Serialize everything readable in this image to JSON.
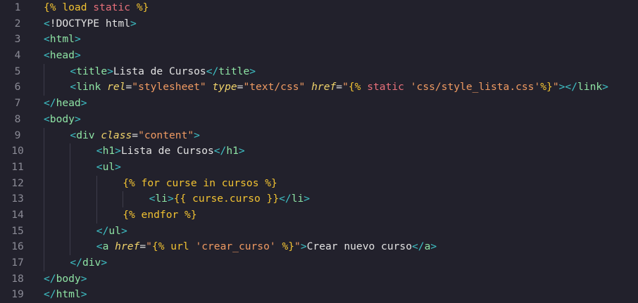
{
  "editor": {
    "lines": [
      {
        "n": "1",
        "indent": 0,
        "tokens": [
          [
            "tpl",
            "{% "
          ],
          [
            "tpl",
            "load "
          ],
          [
            "kw",
            "static "
          ],
          [
            "tpl",
            "%}"
          ]
        ]
      },
      {
        "n": "2",
        "indent": 0,
        "tokens": [
          [
            "br",
            "<"
          ],
          [
            "txt",
            "!DOCTYPE html"
          ],
          [
            "br",
            ">"
          ]
        ]
      },
      {
        "n": "3",
        "indent": 0,
        "tokens": [
          [
            "br",
            "<"
          ],
          [
            "tag",
            "html"
          ],
          [
            "br",
            ">"
          ]
        ]
      },
      {
        "n": "4",
        "indent": 0,
        "tokens": [
          [
            "br",
            "<"
          ],
          [
            "tag",
            "head"
          ],
          [
            "br",
            ">"
          ]
        ]
      },
      {
        "n": "5",
        "indent": 1,
        "tokens": [
          [
            "br",
            "<"
          ],
          [
            "tag",
            "title"
          ],
          [
            "br",
            ">"
          ],
          [
            "txt",
            "Lista de Cursos"
          ],
          [
            "br",
            "</"
          ],
          [
            "tag",
            "title"
          ],
          [
            "br",
            ">"
          ]
        ]
      },
      {
        "n": "6",
        "indent": 1,
        "tokens": [
          [
            "br",
            "<"
          ],
          [
            "tag",
            "link "
          ],
          [
            "attr",
            "rel"
          ],
          [
            "eq",
            "="
          ],
          [
            "str",
            "\"stylesheet\" "
          ],
          [
            "attr",
            "type"
          ],
          [
            "eq",
            "="
          ],
          [
            "str",
            "\"text/css\" "
          ],
          [
            "attr",
            "href"
          ],
          [
            "eq",
            "="
          ],
          [
            "str",
            "\""
          ],
          [
            "tpl",
            "{% "
          ],
          [
            "kw",
            "static "
          ],
          [
            "str",
            "'css/style_lista.css'"
          ],
          [
            "tpl",
            "%}"
          ],
          [
            "str",
            "\""
          ],
          [
            "br",
            "></"
          ],
          [
            "tag",
            "link"
          ],
          [
            "br",
            ">"
          ]
        ]
      },
      {
        "n": "7",
        "indent": 0,
        "tokens": [
          [
            "br",
            "</"
          ],
          [
            "tag",
            "head"
          ],
          [
            "br",
            ">"
          ]
        ]
      },
      {
        "n": "8",
        "indent": 0,
        "tokens": [
          [
            "br",
            "<"
          ],
          [
            "tag",
            "body"
          ],
          [
            "br",
            ">"
          ]
        ]
      },
      {
        "n": "9",
        "indent": 1,
        "tokens": [
          [
            "br",
            "<"
          ],
          [
            "tag",
            "div "
          ],
          [
            "attr",
            "class"
          ],
          [
            "eq",
            "="
          ],
          [
            "str",
            "\"content\""
          ],
          [
            "br",
            ">"
          ]
        ]
      },
      {
        "n": "10",
        "indent": 2,
        "tokens": [
          [
            "br",
            "<"
          ],
          [
            "tag",
            "h1"
          ],
          [
            "br",
            ">"
          ],
          [
            "txt",
            "Lista de Cursos"
          ],
          [
            "br",
            "</"
          ],
          [
            "tag",
            "h1"
          ],
          [
            "br",
            ">"
          ]
        ]
      },
      {
        "n": "11",
        "indent": 2,
        "tokens": [
          [
            "br",
            "<"
          ],
          [
            "tag",
            "ul"
          ],
          [
            "br",
            ">"
          ]
        ]
      },
      {
        "n": "12",
        "indent": 3,
        "tokens": [
          [
            "tpl",
            "{% for curse in cursos %}"
          ]
        ]
      },
      {
        "n": "13",
        "indent": 4,
        "tokens": [
          [
            "br",
            "<"
          ],
          [
            "tag",
            "li"
          ],
          [
            "br",
            ">"
          ],
          [
            "tpl",
            "{{ curse.curso }}"
          ],
          [
            "br",
            "</"
          ],
          [
            "tag",
            "li"
          ],
          [
            "br",
            ">"
          ]
        ]
      },
      {
        "n": "14",
        "indent": 3,
        "tokens": [
          [
            "tpl",
            "{% endfor %}"
          ]
        ]
      },
      {
        "n": "15",
        "indent": 2,
        "tokens": [
          [
            "br",
            "</"
          ],
          [
            "tag",
            "ul"
          ],
          [
            "br",
            ">"
          ]
        ]
      },
      {
        "n": "16",
        "indent": 2,
        "tokens": [
          [
            "br",
            "<"
          ],
          [
            "tag",
            "a "
          ],
          [
            "attr",
            "href"
          ],
          [
            "eq",
            "="
          ],
          [
            "str",
            "\""
          ],
          [
            "tpl",
            "{% "
          ],
          [
            "tpl",
            "url "
          ],
          [
            "str",
            "'crear_curso' "
          ],
          [
            "tpl",
            "%}"
          ],
          [
            "str",
            "\""
          ],
          [
            "br",
            ">"
          ],
          [
            "txt",
            "Crear nuevo curso"
          ],
          [
            "br",
            "</"
          ],
          [
            "tag",
            "a"
          ],
          [
            "br",
            ">"
          ]
        ]
      },
      {
        "n": "17",
        "indent": 1,
        "tokens": [
          [
            "br",
            "</"
          ],
          [
            "tag",
            "div"
          ],
          [
            "br",
            ">"
          ]
        ]
      },
      {
        "n": "18",
        "indent": 0,
        "tokens": [
          [
            "br",
            "</"
          ],
          [
            "tag",
            "body"
          ],
          [
            "br",
            ">"
          ]
        ]
      },
      {
        "n": "19",
        "indent": 0,
        "tokens": [
          [
            "br",
            "</"
          ],
          [
            "tag",
            "html"
          ],
          [
            "br",
            ">"
          ]
        ]
      }
    ]
  }
}
